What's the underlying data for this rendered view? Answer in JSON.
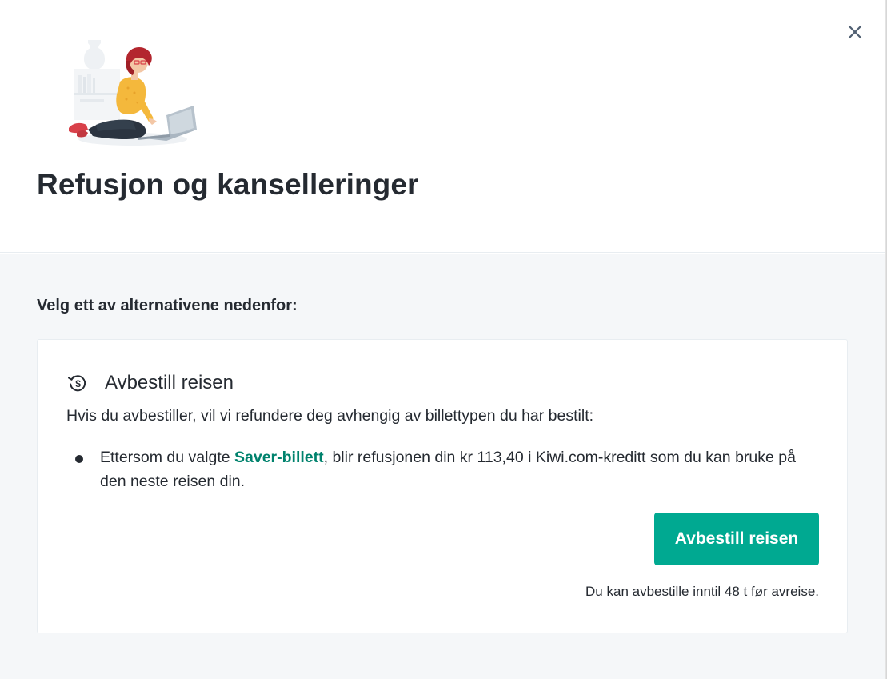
{
  "header": {
    "title": "Refusjon og kanselleringer",
    "close_icon": "close-icon",
    "illustration": "woman-with-laptop-illustration"
  },
  "main": {
    "prompt": "Velg ett av alternativene nedenfor:",
    "option": {
      "icon": "money-refund-icon",
      "title": "Avbestill reisen",
      "description": "Hvis du avbestiller, vil vi refundere deg avhengig av billettypen du har bestilt:",
      "bullets": [
        {
          "prefix": "Ettersom du valgte ",
          "link": "Saver-billett",
          "suffix": ", blir refusjonen din kr 113,40 i Kiwi.com-kreditt som du kan bruke på den neste reisen din."
        }
      ],
      "button_label": "Avbestill reisen",
      "note": "Du kan avbestille inntil 48 t før avreise."
    }
  },
  "colors": {
    "primary": "#00a991",
    "link": "#00826d",
    "text": "#252a31",
    "background_body": "#f5f7f9",
    "card_border": "#e8edf1"
  }
}
